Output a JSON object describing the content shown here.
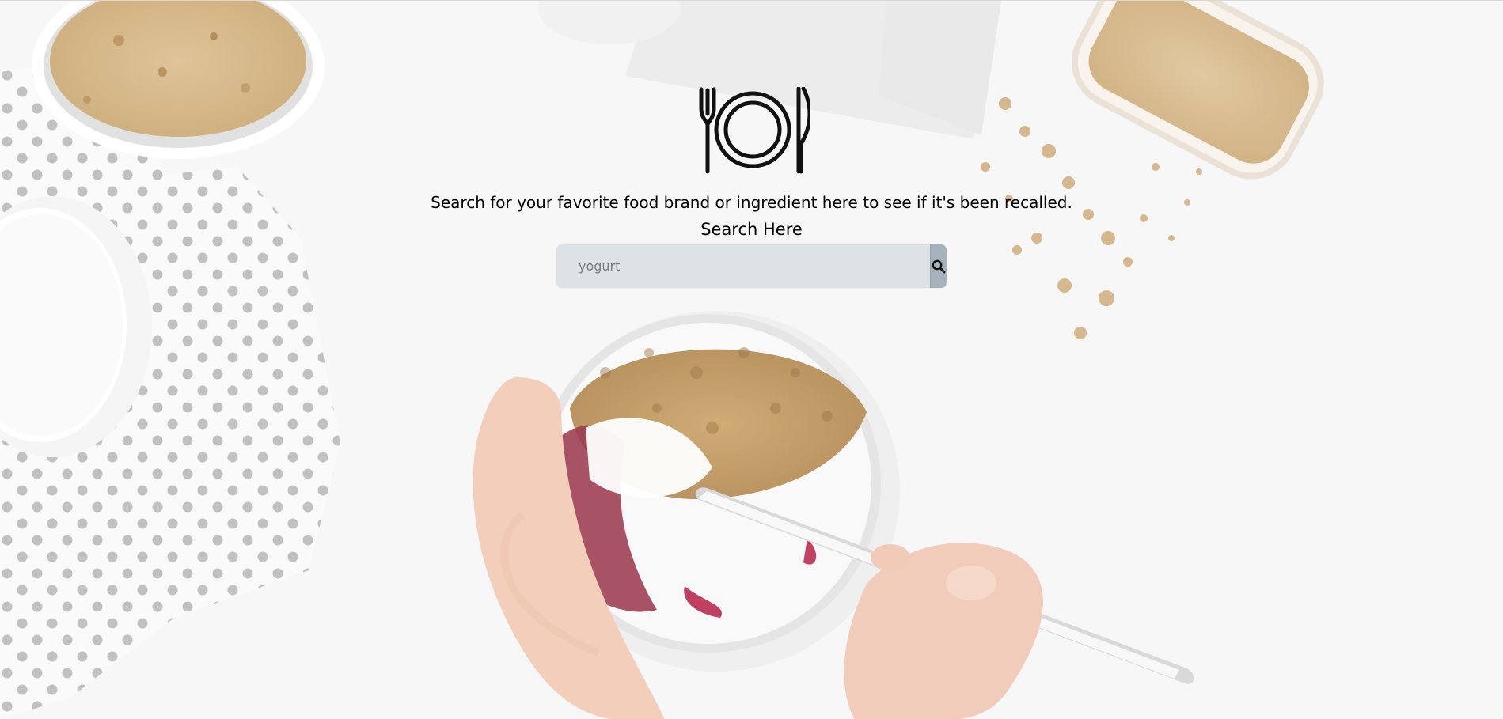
{
  "hero": {
    "tagline": "Search for your favorite food brand or ingredient here to see if it's been recalled.",
    "search_label": "Search Here"
  },
  "search": {
    "placeholder": "yogurt",
    "value": ""
  },
  "icons": {
    "logo": "fork-plate-knife-icon",
    "search": "search-icon"
  },
  "colors": {
    "search_field": "#dde2e6",
    "search_button": "#a6b2bc",
    "text": "#000000"
  }
}
